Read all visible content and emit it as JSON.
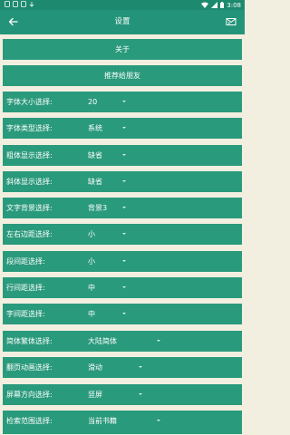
{
  "status_bar": {
    "time": "3:08",
    "left_icons": [
      "gear-icon",
      "notification-icon",
      "shield-icon",
      "download-icon"
    ],
    "right_icons": [
      "wifi-icon",
      "signal-icon",
      "battery-icon"
    ]
  },
  "appbar": {
    "title": "设置",
    "back_icon": "back-arrow-icon",
    "action_icon": "mail-icon"
  },
  "buttons": {
    "about": "关于",
    "recommend": "推荐给朋友"
  },
  "settings": [
    {
      "label": "字体大小选择:",
      "value": "20"
    },
    {
      "label": "字体类型选择:",
      "value": "系统"
    },
    {
      "label": "粗体显示选择:",
      "value": "缺省"
    },
    {
      "label": "斜体显示选择:",
      "value": "缺省"
    },
    {
      "label": "文字背景选择:",
      "value": "背景3"
    },
    {
      "label": "左右边距选择:",
      "value": "小"
    },
    {
      "label": "段间距选择:",
      "value": "小"
    },
    {
      "label": "行间距选择:",
      "value": "中"
    },
    {
      "label": "字间距选择:",
      "value": "中"
    },
    {
      "label": "简体繁体选择:",
      "value": "大陆简体"
    },
    {
      "label": "翻页动画选择:",
      "value": "滑动"
    },
    {
      "label": "屏幕方向选择:",
      "value": "竖屏"
    },
    {
      "label": "检索范围选择:",
      "value": "当前书籍"
    }
  ],
  "colors": {
    "status_bar": "#1d8a6f",
    "appbar": "#239479",
    "row": "#2a9a7c",
    "background": "#f3efe0"
  }
}
